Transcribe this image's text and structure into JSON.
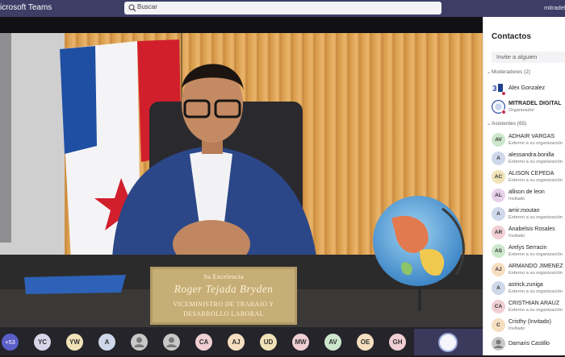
{
  "app": {
    "title": "icrosoft Teams",
    "user": "mitradel.g"
  },
  "search": {
    "placeholder": "Buscar"
  },
  "placard": {
    "honorific": "Su Excelencia",
    "name": "Roger Tejada Bryden",
    "role_line1": "VICEMINISTRO DE TRABAJO Y",
    "role_line2": "DESARROLLO LABORAL"
  },
  "strip": {
    "more_count": "+53",
    "chips": [
      {
        "initials": "YC",
        "color": "#d9d4ea"
      },
      {
        "initials": "YW",
        "color": "#f1e3b8"
      },
      {
        "initials": "A",
        "color": "#cfd8ea"
      },
      {
        "initials": "",
        "color": "#c8c8c8"
      },
      {
        "initials": "",
        "color": "#c8c8c8"
      },
      {
        "initials": "CA",
        "color": "#f0cfd4"
      },
      {
        "initials": "AJ",
        "color": "#f6dec0"
      },
      {
        "initials": "UD",
        "color": "#f1e3b8"
      },
      {
        "initials": "MW",
        "color": "#f0cfd4"
      },
      {
        "initials": "AV",
        "color": "#cde7cd"
      },
      {
        "initials": "OE",
        "color": "#f6dec0"
      },
      {
        "initials": "GH",
        "color": "#f0cfd4"
      }
    ]
  },
  "panel": {
    "title": "Contactos",
    "invite_placeholder": "Invite a alguien",
    "moderators_label": "Moderadores (2)",
    "attendees_label": "Asistentes (65)",
    "moderators": [
      {
        "initials": "",
        "name": "Alex Gonzalez",
        "sub": "",
        "color": "#ffffff"
      },
      {
        "initials": "",
        "name": "MITRADEL DIGITAL",
        "sub": "Organizador",
        "color": "#ffffff"
      }
    ],
    "attendees": [
      {
        "initials": "AV",
        "name": "ADHAIR VARGAS",
        "sub": "Externo a su organización",
        "color": "#cde7cd"
      },
      {
        "initials": "A",
        "name": "alessandra.bonilla",
        "sub": "Externo a su organización",
        "color": "#cfd8ea"
      },
      {
        "initials": "AC",
        "name": "ALISON CEPEDA",
        "sub": "Externo a su organización",
        "color": "#f1e3b8"
      },
      {
        "initials": "AL",
        "name": "allison de leon",
        "sub": "Invitado",
        "color": "#e8d0ea"
      },
      {
        "initials": "A",
        "name": "amir.moutan",
        "sub": "Externo a su organización",
        "color": "#cfd8ea"
      },
      {
        "initials": "AR",
        "name": "Anabelsis Rosales",
        "sub": "Invitado",
        "color": "#f0cfd4"
      },
      {
        "initials": "AS",
        "name": "Arelys Serracin",
        "sub": "Externo a su organización",
        "color": "#cde7cd"
      },
      {
        "initials": "AJ",
        "name": "ARMANDO JIMENEZ",
        "sub": "Externo a su organización",
        "color": "#f6dec0"
      },
      {
        "initials": "A",
        "name": "astrick.zuniga",
        "sub": "Externo a su organización",
        "color": "#cfd8ea"
      },
      {
        "initials": "CA",
        "name": "CRISTHIAN ARAUZ",
        "sub": "Externo a su organización",
        "color": "#f0cfd4"
      },
      {
        "initials": "C",
        "name": "Cristhy (Invitado)",
        "sub": "Invitado",
        "color": "#f6dec0"
      },
      {
        "initials": "",
        "name": "Damaris Castillo",
        "sub": "",
        "color": "#c8c8c8"
      }
    ]
  },
  "colors": {
    "titlebar": "#3d3e66",
    "accent": "#5b5fc7",
    "status_busy": "#c4314b"
  }
}
